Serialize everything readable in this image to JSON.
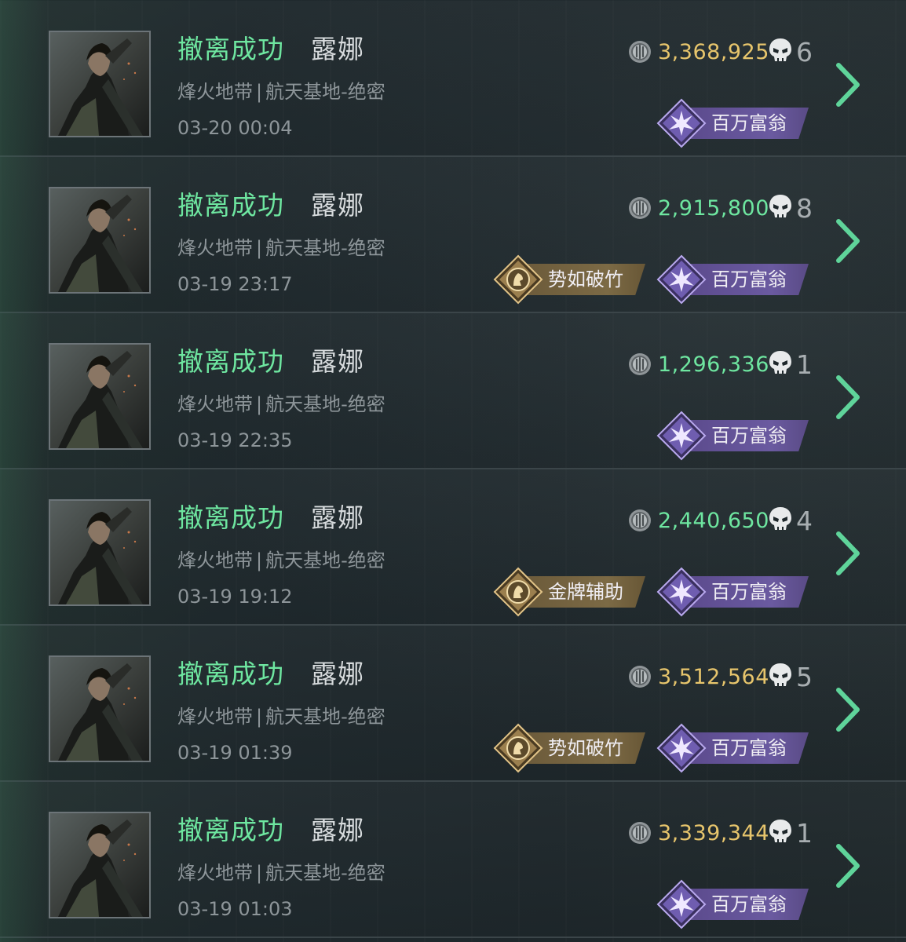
{
  "colors": {
    "status_green": "#6ee6a0",
    "value_gold": "#e7c56c",
    "value_green": "#6ee6a0",
    "badge_purple": "#6a5aa0",
    "badge_gold": "#7c6a45",
    "chevron_green": "#5fd49a"
  },
  "icons": {
    "coin": "silver-coin-icon",
    "kills": "skull-icon",
    "detail": "chevron-right-icon",
    "tycoon_badge": "purple-burst-emblem-icon",
    "medal_badge": "gold-operator-emblem-icon"
  },
  "records": [
    {
      "status": "撤离成功",
      "operator": "露娜",
      "mode": "烽火地带",
      "separator": "|",
      "map": "航天基地-绝密",
      "time": "03-20 00:04",
      "value": "3,368,925",
      "value_tone": "gold",
      "kills": "6",
      "badges": [
        {
          "label": "百万富翁",
          "tone": "purple"
        }
      ]
    },
    {
      "status": "撤离成功",
      "operator": "露娜",
      "mode": "烽火地带",
      "separator": "|",
      "map": "航天基地-绝密",
      "time": "03-19 23:17",
      "value": "2,915,800",
      "value_tone": "green",
      "kills": "8",
      "badges": [
        {
          "label": "势如破竹",
          "tone": "gold"
        },
        {
          "label": "百万富翁",
          "tone": "purple"
        }
      ]
    },
    {
      "status": "撤离成功",
      "operator": "露娜",
      "mode": "烽火地带",
      "separator": "|",
      "map": "航天基地-绝密",
      "time": "03-19 22:35",
      "value": "1,296,336",
      "value_tone": "green",
      "kills": "1",
      "badges": [
        {
          "label": "百万富翁",
          "tone": "purple"
        }
      ]
    },
    {
      "status": "撤离成功",
      "operator": "露娜",
      "mode": "烽火地带",
      "separator": "|",
      "map": "航天基地-绝密",
      "time": "03-19 19:12",
      "value": "2,440,650",
      "value_tone": "green",
      "kills": "4",
      "badges": [
        {
          "label": "金牌辅助",
          "tone": "gold"
        },
        {
          "label": "百万富翁",
          "tone": "purple"
        }
      ]
    },
    {
      "status": "撤离成功",
      "operator": "露娜",
      "mode": "烽火地带",
      "separator": "|",
      "map": "航天基地-绝密",
      "time": "03-19 01:39",
      "value": "3,512,564",
      "value_tone": "gold",
      "kills": "5",
      "badges": [
        {
          "label": "势如破竹",
          "tone": "gold"
        },
        {
          "label": "百万富翁",
          "tone": "purple"
        }
      ]
    },
    {
      "status": "撤离成功",
      "operator": "露娜",
      "mode": "烽火地带",
      "separator": "|",
      "map": "航天基地-绝密",
      "time": "03-19 01:03",
      "value": "3,339,344",
      "value_tone": "gold",
      "kills": "1",
      "badges": [
        {
          "label": "百万富翁",
          "tone": "purple"
        }
      ]
    }
  ]
}
